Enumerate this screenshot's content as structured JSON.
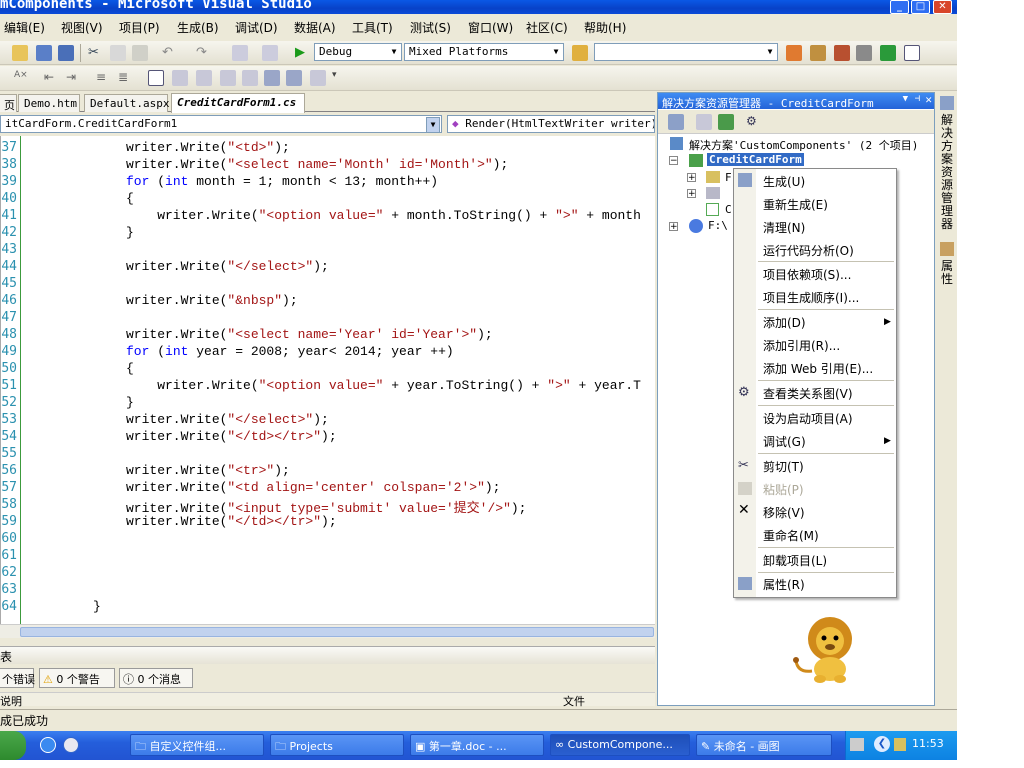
{
  "window": {
    "title": "mComponents - Microsoft Visual Studio"
  },
  "menu": [
    "编辑(E)",
    "视图(V)",
    "项目(P)",
    "生成(B)",
    "调试(D)",
    "数据(A)",
    "工具(T)",
    "测试(S)",
    "窗口(W)",
    "社区(C)",
    "帮助(H)"
  ],
  "toolbar": {
    "config": "Debug",
    "platform": "Mixed Platforms",
    "find": ""
  },
  "tabs": [
    "页",
    "Demo.htm",
    "Default.aspx",
    "CreditCardForm1.cs"
  ],
  "nav": {
    "type": "itCardForm.CreditCardForm1",
    "member": "Render(HtmlTextWriter writer)"
  },
  "code": {
    "lines": [
      {
        "n": "37",
        "t": "writer.Write(\"<td>\");"
      },
      {
        "n": "38",
        "t": "writer.Write(\"<select name='Month' id='Month'>\");"
      },
      {
        "n": "39",
        "t": "for (int month = 1; month < 13; month++)"
      },
      {
        "n": "40",
        "t": "{"
      },
      {
        "n": "41",
        "t": "    writer.Write(\"<option value=\" + month.ToString() + \">\" + month"
      },
      {
        "n": "42",
        "t": "}"
      },
      {
        "n": "43",
        "t": ""
      },
      {
        "n": "44",
        "t": "writer.Write(\"</select>\");"
      },
      {
        "n": "45",
        "t": ""
      },
      {
        "n": "46",
        "t": "writer.Write(\"&nbsp\");"
      },
      {
        "n": "47",
        "t": ""
      },
      {
        "n": "48",
        "t": "writer.Write(\"<select name='Year' id='Year'>\");"
      },
      {
        "n": "49",
        "t": "for (int year = 2008; year< 2014; year ++)"
      },
      {
        "n": "50",
        "t": "{"
      },
      {
        "n": "51",
        "t": "    writer.Write(\"<option value=\" + year.ToString() + \">\" + year.T"
      },
      {
        "n": "52",
        "t": "}"
      },
      {
        "n": "53",
        "t": "writer.Write(\"</select>\");"
      },
      {
        "n": "54",
        "t": "writer.Write(\"</td></tr>\");"
      },
      {
        "n": "55",
        "t": ""
      },
      {
        "n": "56",
        "t": "writer.Write(\"<tr>\");"
      },
      {
        "n": "57",
        "t": "writer.Write(\"<td align='center' colspan='2'>\");"
      },
      {
        "n": "58",
        "t": "writer.Write(\"<input type='submit' value='提交'/>\");"
      },
      {
        "n": "59",
        "t": "writer.Write(\"</td></tr>\");"
      },
      {
        "n": "60",
        "t": ""
      },
      {
        "n": "61",
        "t": ""
      },
      {
        "n": "62",
        "t": ""
      },
      {
        "n": "63",
        "t": ""
      },
      {
        "n": "64",
        "t": "}"
      }
    ]
  },
  "errorlist": {
    "header": "表",
    "errors": "个错误",
    "warnings": "0 个警告",
    "messages": "0 个消息",
    "col_desc": "说明",
    "col_file": "文件"
  },
  "solution": {
    "title": "解决方案资源管理器 - CreditCardForm",
    "root": "解决方案'CustomComponents' (2 个项目)",
    "project": "CreditCardForm",
    "item_a": "F",
    "item_b": "C",
    "item_f": "F:\\"
  },
  "context_menu": {
    "build": "生成(U)",
    "rebuild": "重新生成(E)",
    "clean": "清理(N)",
    "analyze": "运行代码分析(O)",
    "deps": "项目依赖项(S)...",
    "order": "项目生成顺序(I)...",
    "add": "添加(D)",
    "add_ref": "添加引用(R)...",
    "add_web_ref": "添加 Web 引用(E)...",
    "class_diagram": "查看类关系图(V)",
    "startup": "设为启动项目(A)",
    "debug": "调试(G)",
    "cut": "剪切(T)",
    "paste": "粘贴(P)",
    "remove": "移除(V)",
    "rename": "重命名(M)",
    "unload": "卸载项目(L)",
    "properties": "属性(R)"
  },
  "side_tabs": {
    "solution": "解决方案资源管理器",
    "props": "属性"
  },
  "status": {
    "text": "成已成功"
  },
  "taskbar": {
    "items": [
      "自定义控件组...",
      "Projects",
      "第一章.doc - ...",
      "CustomCompone...",
      "未命名 - 画图"
    ],
    "clock": "11:53"
  }
}
